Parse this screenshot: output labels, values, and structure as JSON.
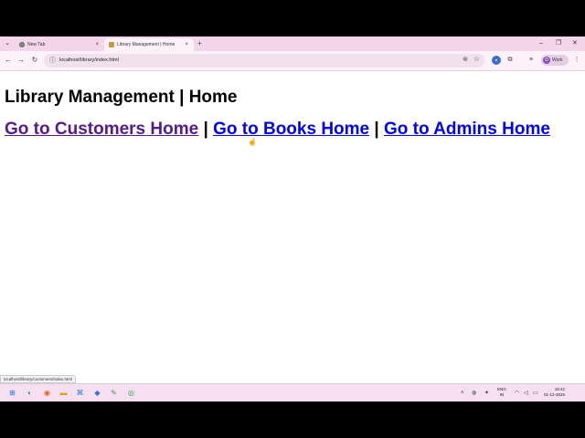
{
  "browser": {
    "tabs": [
      {
        "title": "New Tab",
        "close": "×"
      },
      {
        "title": "Library Management | Home",
        "close": "×"
      }
    ],
    "new_tab_glyph": "+",
    "url": "localhost/library/index.html",
    "profile_initial": "D",
    "profile_name": "Work",
    "status_url": "localhost/library/customers/index.html"
  },
  "page": {
    "heading": "Library Management | Home",
    "links": [
      {
        "label": "Go to Customers Home",
        "visited": true
      },
      {
        "label": "Go to Books Home",
        "visited": false
      },
      {
        "label": "Go to Admins Home",
        "visited": false
      }
    ],
    "separator": "|"
  },
  "taskbar": {
    "lang_top": "ENG",
    "lang_bottom": "IN",
    "time": "18:42",
    "date": "01-12-2025"
  },
  "colors": {
    "link": "#0000ee",
    "visited_link": "#551a8b",
    "browser_frame": "#f3d6ea"
  },
  "icons": [
    "tab-list-icon",
    "globe-icon",
    "library-favicon",
    "back-icon",
    "forward-icon",
    "reload-icon",
    "site-info-icon",
    "zoom-icon",
    "star-icon",
    "extension-icon",
    "puzzle-icon",
    "media-icon",
    "menu-icon",
    "windows-start-icon",
    "search-icon",
    "edge-icon",
    "firefox-icon",
    "folder-icon",
    "vscode-icon",
    "chrome-icon",
    "wifi-icon",
    "volume-icon",
    "battery-icon"
  ]
}
